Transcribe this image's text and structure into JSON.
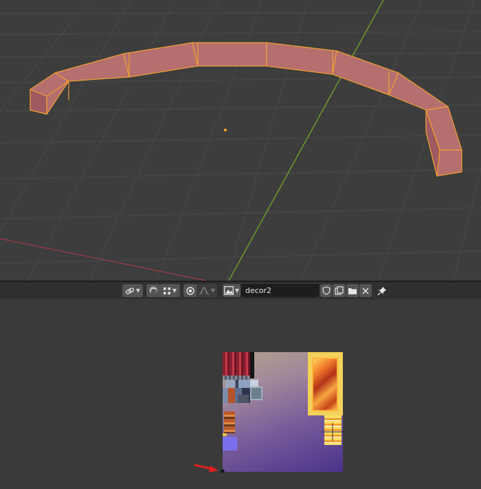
{
  "uv_editor": {
    "header": {
      "image_name": "decor2",
      "icons": {
        "sync_link": "link-icon",
        "snap": "snap-magnet-icon",
        "snap_target": "snap-grid-icon",
        "proportional": "proportional-editing-icon",
        "falloff": "falloff-curve-icon",
        "image_browse": "image-browse-icon",
        "fake_user": "shield-icon",
        "new_image": "new-image-icon",
        "open_image": "folder-icon",
        "unlink": "close-icon",
        "pin": "pin-icon"
      }
    }
  },
  "colors": {
    "viewport_bg": "#3d3d3d",
    "grid": "#4a4a4a",
    "y_axis": "#6e9a29",
    "x_axis": "#a03a48",
    "mesh_face": "#b56f6f",
    "mesh_edge": "#f0a030",
    "uv_bg": "#3a3a3a",
    "header_bg": "#303030",
    "annotation_arrow": "#e02020"
  }
}
